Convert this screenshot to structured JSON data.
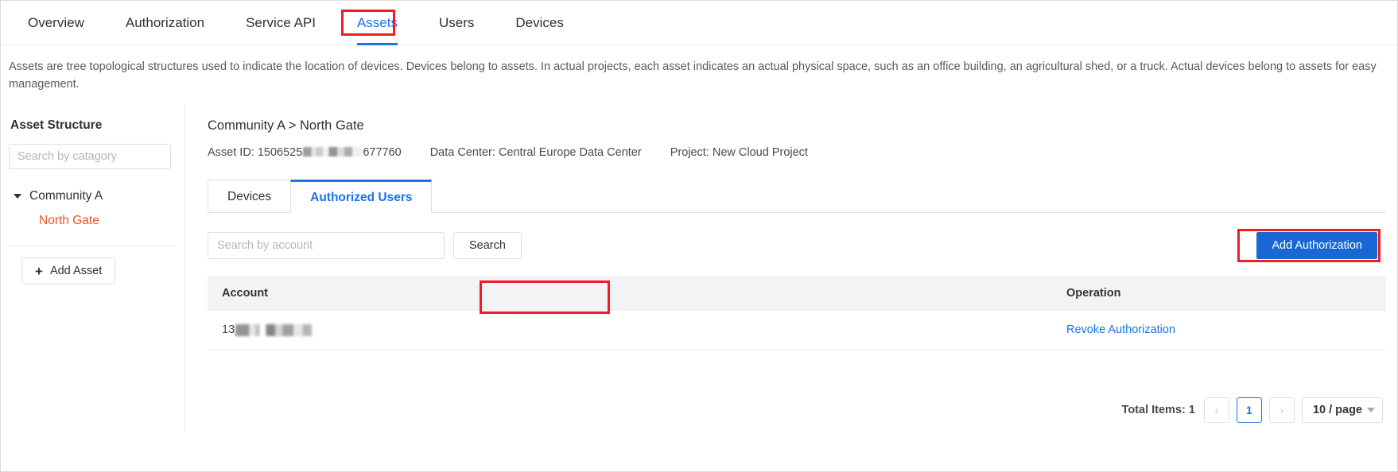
{
  "topnav": {
    "items": [
      {
        "label": "Overview",
        "active": false
      },
      {
        "label": "Authorization",
        "active": false
      },
      {
        "label": "Service API",
        "active": false
      },
      {
        "label": "Assets",
        "active": true
      },
      {
        "label": "Users",
        "active": false
      },
      {
        "label": "Devices",
        "active": false
      }
    ]
  },
  "description": "Assets are tree topological structures used to indicate the location of devices. Devices belong to assets. In actual projects, each asset indicates an actual physical space, such as an office building, an agricultural shed, or a truck. Actual devices belong to assets for easy management.",
  "sidebar": {
    "title": "Asset Structure",
    "search_placeholder": "Search by catagory",
    "search_value": "",
    "tree": {
      "root_label": "Community A",
      "child_label": "North Gate"
    },
    "add_asset_label": "Add Asset",
    "plus_icon": "+"
  },
  "content": {
    "breadcrumb": "Community A > North Gate",
    "meta": {
      "asset_id_label": "Asset ID:",
      "asset_id_prefix": "1506525",
      "asset_id_suffix": "677760",
      "data_center": "Data Center: Central Europe Data Center",
      "project": "Project: New Cloud Project"
    },
    "tabs": [
      {
        "label": "Devices",
        "active": false
      },
      {
        "label": "Authorized Users",
        "active": true
      }
    ],
    "search": {
      "placeholder": "Search by account",
      "value": "",
      "button_label": "Search"
    },
    "add_authorization_label": "Add Authorization",
    "table": {
      "columns": [
        "Account",
        "Operation"
      ],
      "rows": [
        {
          "account_prefix": "13",
          "operation": "Revoke Authorization"
        }
      ]
    },
    "pagination": {
      "total_label": "Total Items: 1",
      "prev_icon": "‹",
      "current_page": "1",
      "next_icon": "›",
      "page_size_label": "10 / page"
    }
  },
  "colors": {
    "accent_blue": "#1a73e8",
    "button_blue": "#1967d2",
    "annotation_red": "#ee1c25",
    "tree_selected_orange": "#f05423"
  }
}
